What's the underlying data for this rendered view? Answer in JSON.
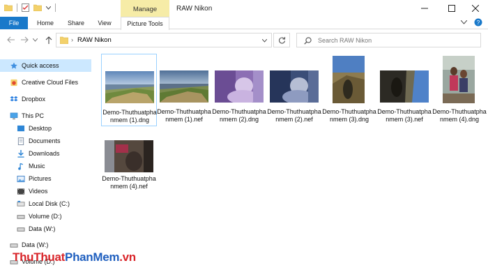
{
  "window": {
    "title": "RAW Nikon",
    "context_tab": "Manage",
    "minimize_icon": "minimize-icon",
    "maximize_icon": "maximize-icon",
    "close_icon": "close-icon"
  },
  "ribbon": {
    "tabs": [
      {
        "label": "File"
      },
      {
        "label": "Home"
      },
      {
        "label": "Share"
      },
      {
        "label": "View"
      },
      {
        "label": "Picture Tools"
      }
    ]
  },
  "address": {
    "path": "RAW Nikon",
    "search_placeholder": "Search RAW Nikon"
  },
  "nav": {
    "items": [
      {
        "label": "Quick access",
        "icon": "star-icon"
      },
      {
        "label": "Creative Cloud Files",
        "icon": "creative-cloud-icon"
      },
      {
        "label": "Dropbox",
        "icon": "dropbox-icon"
      },
      {
        "label": "This PC",
        "icon": "computer-icon"
      },
      {
        "label": "Desktop",
        "icon": "desktop-icon"
      },
      {
        "label": "Documents",
        "icon": "documents-icon"
      },
      {
        "label": "Downloads",
        "icon": "downloads-icon"
      },
      {
        "label": "Music",
        "icon": "music-icon"
      },
      {
        "label": "Pictures",
        "icon": "pictures-icon"
      },
      {
        "label": "Videos",
        "icon": "videos-icon"
      },
      {
        "label": "Local Disk (C:)",
        "icon": "drive-icon"
      },
      {
        "label": "Volume (D:)",
        "icon": "drive-icon"
      },
      {
        "label": "Data (W:)",
        "icon": "drive-icon"
      },
      {
        "label": "Data (W:)",
        "icon": "drive-icon"
      },
      {
        "label": "Volume (D:)",
        "icon": "drive-icon"
      }
    ]
  },
  "files": [
    {
      "name": "Demo-Thuthuatphanmem (1).dng"
    },
    {
      "name": "Demo-Thuthuatphanmem (1).nef"
    },
    {
      "name": "Demo-Thuthuatphanmem (2).dng"
    },
    {
      "name": "Demo-Thuthuatphanmem (2).nef"
    },
    {
      "name": "Demo-Thuthuatphanmem (3).dng"
    },
    {
      "name": "Demo-Thuthuatphanmem (3).nef"
    },
    {
      "name": "Demo-Thuthuatphanmem (4).dng"
    },
    {
      "name": "Demo-Thuthuatphanmem (4).nef"
    }
  ],
  "watermark": {
    "part1": "ThuThuat",
    "part2": "PhanMem",
    "part3": ".vn"
  },
  "colors": {
    "accent": "#1979ca",
    "selection": "#cce8ff",
    "manage_band": "#f6eca7",
    "watermark_red": "#d9252a",
    "watermark_blue": "#1f5fbf"
  }
}
